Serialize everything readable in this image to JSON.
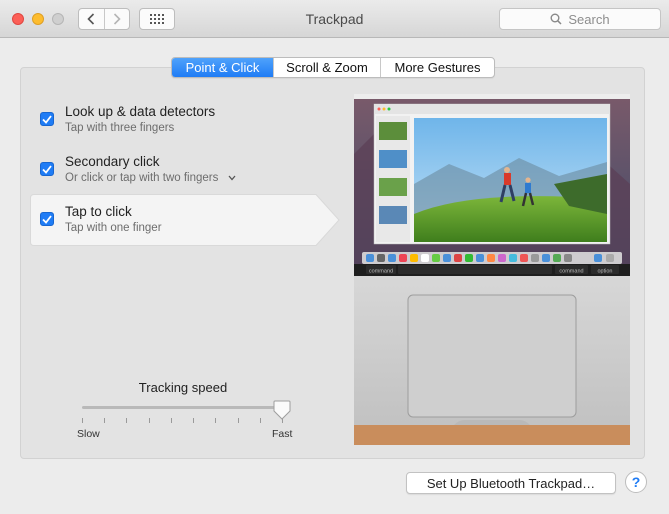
{
  "window": {
    "title": "Trackpad",
    "search_placeholder": "Search"
  },
  "tabs": [
    {
      "label": "Point & Click",
      "active": true
    },
    {
      "label": "Scroll & Zoom",
      "active": false
    },
    {
      "label": "More Gestures",
      "active": false
    }
  ],
  "options": [
    {
      "title": "Look up & data detectors",
      "subtitle": "Tap with three fingers",
      "checked": true,
      "has_dropdown": false
    },
    {
      "title": "Secondary click",
      "subtitle": "Or click or tap with two fingers",
      "checked": true,
      "has_dropdown": true
    },
    {
      "title": "Tap to click",
      "subtitle": "Tap with one finger",
      "checked": true,
      "has_dropdown": false,
      "selected": true
    }
  ],
  "tracking": {
    "title": "Tracking speed",
    "min_label": "Slow",
    "max_label": "Fast",
    "level": 1.0,
    "tick_count": 10
  },
  "preview": {
    "keyboard": {
      "left_key": "command",
      "right_key_1": "command",
      "right_key_2": "option"
    }
  },
  "bottom": {
    "bluetooth_button": "Set Up Bluetooth Trackpad…",
    "help_label": "?"
  },
  "colors": {
    "accent": "#1f7cf5",
    "window_bg": "#ececec",
    "panel_bg": "#e3e3e3"
  }
}
